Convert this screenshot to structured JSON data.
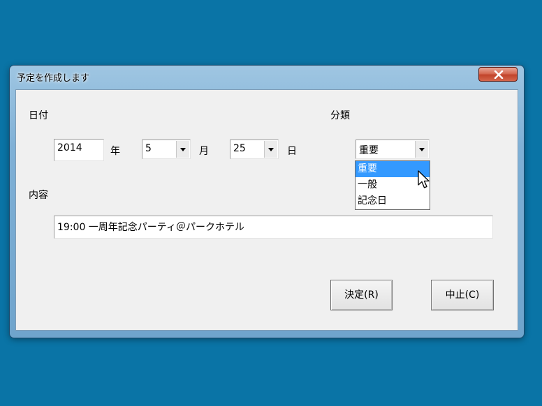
{
  "window": {
    "title": "予定を作成します"
  },
  "form": {
    "date_label": "日付",
    "category_label": "分類",
    "content_label": "内容",
    "year_value": "2014",
    "year_unit": "年",
    "month_value": "5",
    "month_unit": "月",
    "day_value": "25",
    "day_unit": "日",
    "category_value": "重要",
    "category_options": [
      "重要",
      "一般",
      "記念日"
    ],
    "content_value": "19:00 一周年記念パーティ＠パークホテル"
  },
  "buttons": {
    "ok_label": "決定(R)",
    "cancel_label": "中止(C)"
  }
}
